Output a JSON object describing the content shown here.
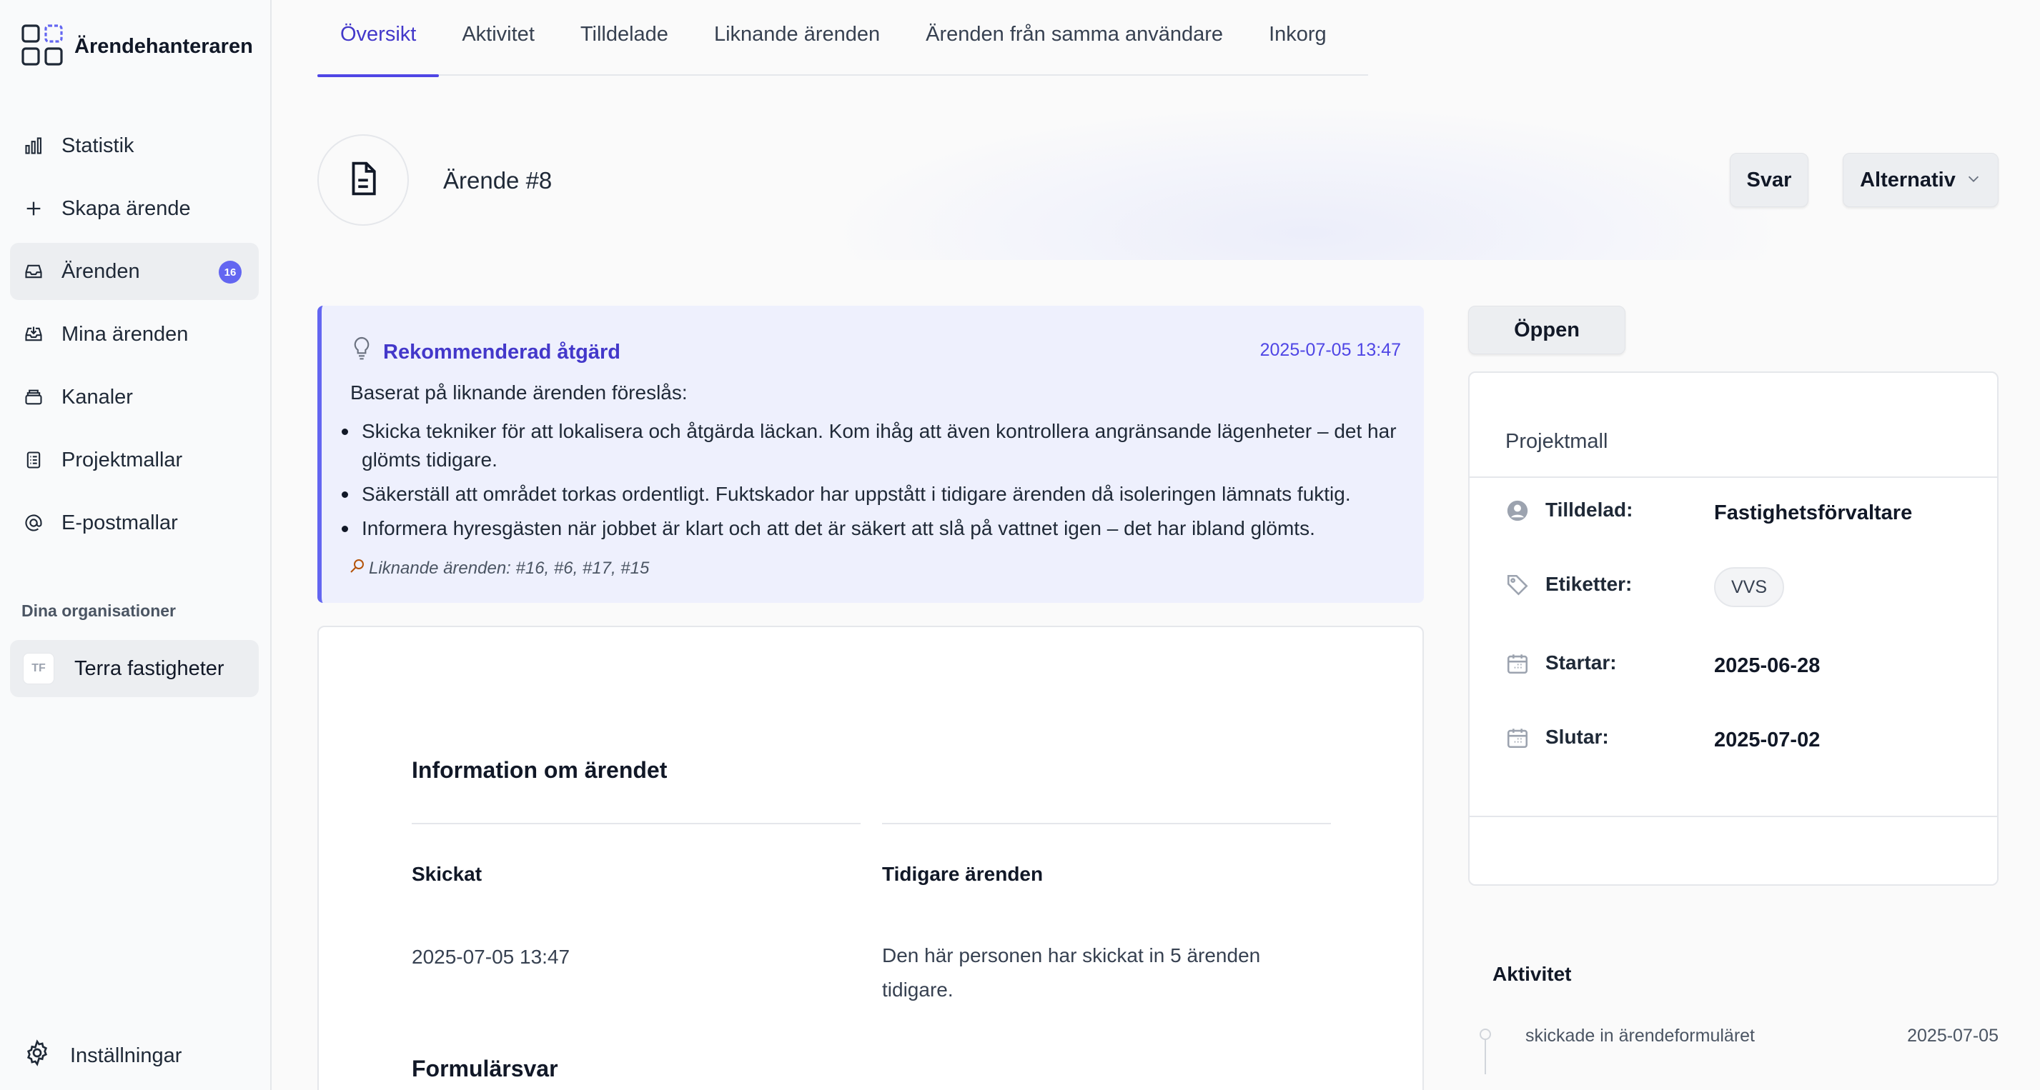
{
  "app": {
    "name": "Ärendehanteraren"
  },
  "sidebar": {
    "items": [
      {
        "label": "Statistik",
        "icon": "bar-chart-icon"
      },
      {
        "label": "Skapa ärende",
        "icon": "plus-icon"
      },
      {
        "label": "Ärenden",
        "icon": "inbox-icon",
        "badge": "16",
        "active": true
      },
      {
        "label": "Mina ärenden",
        "icon": "inbox-download-icon"
      },
      {
        "label": "Kanaler",
        "icon": "stack-icon"
      },
      {
        "label": "Projektmallar",
        "icon": "clipboard-list-icon"
      },
      {
        "label": "E-postmallar",
        "icon": "at-sign-icon"
      }
    ],
    "orgs_heading": "Dina organisationer",
    "org": {
      "initials": "TF",
      "name": "Terra fastigheter"
    },
    "settings_label": "Inställningar"
  },
  "tabs": [
    {
      "label": "Översikt",
      "active": true
    },
    {
      "label": "Aktivitet"
    },
    {
      "label": "Tilldelade"
    },
    {
      "label": "Liknande ärenden"
    },
    {
      "label": "Ärenden från samma användare"
    },
    {
      "label": "Inkorg"
    }
  ],
  "header": {
    "title": "Ärende #8",
    "reply_label": "Svar",
    "options_label": "Alternativ"
  },
  "recommendation": {
    "title": "Rekommenderad åtgärd",
    "timestamp": "2025-07-05 13:47",
    "intro": "Baserat på liknande ärenden föreslås:",
    "items": [
      "Skicka tekniker för att lokalisera och åtgärda läckan. Kom ihåg att även kontrollera angränsande lägenheter – det har glömts tidigare.",
      "Säkerställ att området torkas ordentligt. Fuktskador har uppstått i tidigare ärenden då isoleringen lämnats fuktig.",
      "Informera hyresgästen när jobbet är klart och att det är säkert att slå på vattnet igen – det har ibland glömts."
    ],
    "similar": "Liknande ärenden: #16, #6, #17, #15"
  },
  "info": {
    "heading": "Information om ärendet",
    "sent_label": "Skickat",
    "sent_value": "2025-07-05 13:47",
    "previous_label": "Tidigare ärenden",
    "previous_value": "Den här personen har skickat in 5 ärenden tidigare.",
    "form_heading": "Formulärsvar"
  },
  "status": {
    "label": "Öppen"
  },
  "meta": {
    "title": "Projektmall",
    "assigned_label": "Tilldelad:",
    "assigned_value": "Fastighetsförvaltare",
    "tags_label": "Etiketter:",
    "tag": "VVS",
    "start_label": "Startar:",
    "start_value": "2025-06-28",
    "end_label": "Slutar:",
    "end_value": "2025-07-02"
  },
  "activity": {
    "heading": "Aktivitet",
    "items": [
      {
        "text": "skickade in ärendeformuläret",
        "date": "2025-07-05"
      }
    ]
  },
  "colors": {
    "accent": "#4f46e5",
    "badge": "#6366f1",
    "reco_bg": "#eef0fd"
  }
}
